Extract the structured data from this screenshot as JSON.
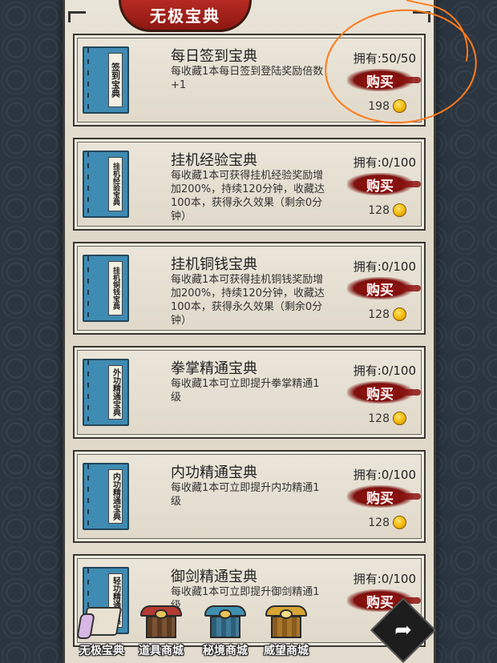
{
  "title": "无极宝典",
  "cards": [
    {
      "book_label": "签到宝典",
      "name": "每日签到宝典",
      "desc": "每收藏1本每日签到登陆奖励倍数+1",
      "owned": "拥有:50/50",
      "buy_label": "购买",
      "price": "198",
      "icon": "coin-icon"
    },
    {
      "book_label": "挂机经验宝典",
      "name": "挂机经验宝典",
      "desc": "每收藏1本可获得挂机经验奖励增加200%，持续120分钟，收藏达100本，获得永久效果（剩余0分钟）",
      "owned": "拥有:0/100",
      "buy_label": "购买",
      "price": "128",
      "icon": "coin-icon"
    },
    {
      "book_label": "挂机铜钱宝典",
      "name": "挂机铜钱宝典",
      "desc": "每收藏1本可获得挂机铜钱奖励增加200%，持续120分钟，收藏达100本，获得永久效果（剩余0分钟）",
      "owned": "拥有:0/100",
      "buy_label": "购买",
      "price": "128",
      "icon": "coin-icon"
    },
    {
      "book_label": "外功精通宝典",
      "name": "拳掌精通宝典",
      "desc": "每收藏1本可立即提升拳掌精通1级",
      "owned": "拥有:0/100",
      "buy_label": "购买",
      "price": "128",
      "icon": "coin-icon"
    },
    {
      "book_label": "内功精通宝典",
      "name": "内功精通宝典",
      "desc": "每收藏1本可立即提升内功精通1级",
      "owned": "拥有:0/100",
      "buy_label": "购买",
      "price": "128",
      "icon": "coin-icon"
    },
    {
      "book_label": "轻功精通宝典",
      "name": "御剑精通宝典",
      "desc": "每收藏1本可立即提升御剑精通1级",
      "owned": "拥有:0/100",
      "buy_label": "购买",
      "price": "",
      "icon": "coin-icon"
    }
  ],
  "nav": [
    {
      "label": "无极宝典",
      "icon": "book-scroll-icon"
    },
    {
      "label": "道具商城",
      "icon": "shop-icon"
    },
    {
      "label": "秘境商城",
      "icon": "shop-icon"
    },
    {
      "label": "威望商城",
      "icon": "shop-icon"
    }
  ],
  "share_icon": "share-arrow-icon",
  "colors": {
    "accent_red": "#8e1712",
    "book_blue": "#3f8bb3",
    "annotation_orange": "#ff7a1a",
    "coin_gold": "#f1b400"
  }
}
